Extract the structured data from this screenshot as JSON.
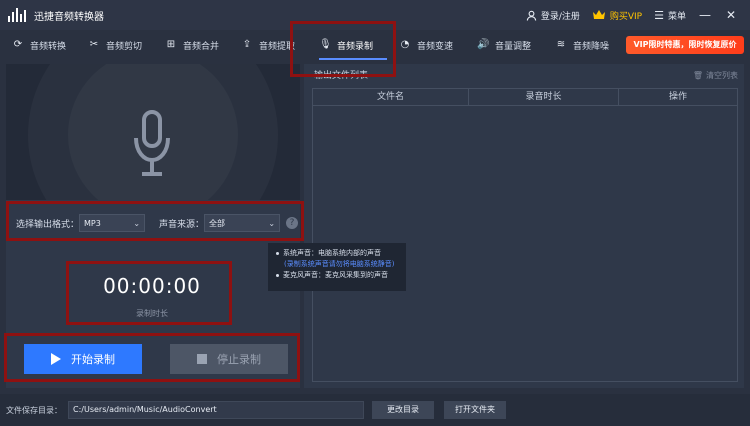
{
  "titlebar": {
    "app_title": "迅捷音频转换器",
    "login": "登录/注册",
    "vip": "购买VIP",
    "menu": "菜单",
    "minimize": "—",
    "close": "✕"
  },
  "nav": {
    "tabs": [
      {
        "label": "音频转换",
        "icon": "refresh-icon"
      },
      {
        "label": "音频剪切",
        "icon": "scissors-icon"
      },
      {
        "label": "音频合并",
        "icon": "merge-icon"
      },
      {
        "label": "音频提取",
        "icon": "upload-icon"
      },
      {
        "label": "音频录制",
        "icon": "microphone-icon"
      },
      {
        "label": "音频变速",
        "icon": "speed-icon"
      },
      {
        "label": "音量调整",
        "icon": "volume-icon"
      },
      {
        "label": "音频降噪",
        "icon": "waveform-icon"
      }
    ],
    "active_index": 4,
    "promo": "VIP限时特惠，限时恢复原价"
  },
  "recorder": {
    "format_label": "选择输出格式：",
    "format_value": "MP3",
    "source_label": "声音来源：",
    "source_value": "全部",
    "help": "?",
    "timer_value": "00:00:00",
    "timer_caption": "录制时长",
    "start_label": "开始录制",
    "stop_label": "停止录制"
  },
  "tooltip": {
    "line1": "系统声音：电脑系统内部的声音",
    "line2": "(录制系统声音请勿将电脑系统静音)",
    "line3": "麦克风声音：麦克风采集到的声音"
  },
  "list": {
    "title": "输出文件列表",
    "clear": "清空列表",
    "columns": [
      "文件名",
      "录音时长",
      "操作"
    ]
  },
  "bottom": {
    "path_label": "文件保存目录：",
    "path_value": "C:/Users/admin/Music/AudioConvert",
    "change_dir": "更改目录",
    "open_folder": "打开文件夹"
  },
  "colors": {
    "accent": "#2e79ff",
    "annotation_red": "#8e1111",
    "promo": "#ff4a22",
    "vip": "#ffc400"
  }
}
